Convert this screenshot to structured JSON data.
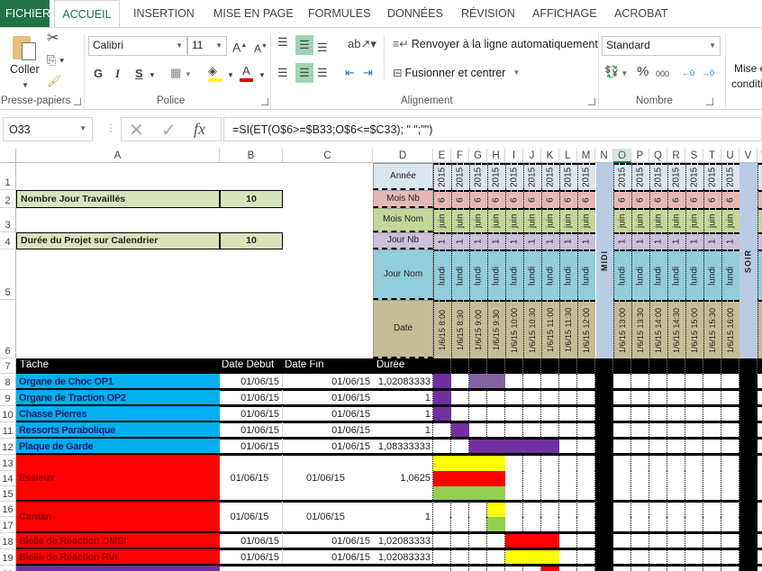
{
  "ribbon": {
    "tabs": [
      "FICHIER",
      "ACCUEIL",
      "INSERTION",
      "MISE EN PAGE",
      "FORMULES",
      "DONNÉES",
      "RÉVISION",
      "AFFICHAGE",
      "ACROBAT"
    ],
    "clipboard": {
      "paste": "Coller",
      "label": "Presse-papiers"
    },
    "font": {
      "name": "Calibri",
      "size": "11",
      "bold": "G",
      "italic": "I",
      "underline": "S",
      "label": "Police"
    },
    "alignment": {
      "wrap": "Renvoyer à la ligne automatiquement",
      "merge": "Fusionner et centrer",
      "label": "Alignement"
    },
    "number": {
      "format": "Standard",
      "percent": "%",
      "thousands": "000",
      "label": "Nombre"
    },
    "styles": {
      "conditional_line1": "Mise en",
      "conditional_line2": "conditionnelle"
    }
  },
  "formula_bar": {
    "name_box": "O33",
    "formula": "=SI(ET(O$6>=$B33;O$6<=$C33); \" \";\"\")",
    "fx": "fx"
  },
  "sheet": {
    "selected_column": "O",
    "summary": [
      {
        "row": 2,
        "label": "Nombre Jour Travaillés",
        "value": "10"
      },
      {
        "row": 4,
        "label": "Durée du Projet sur Calendrier",
        "value": "10"
      }
    ],
    "header_labels": [
      "Année",
      "Mois Nb",
      "Mois Nom",
      "Jour  Nb",
      "Jour Nom",
      "Date"
    ],
    "timeline": {
      "year": "2015",
      "month_nb": "6",
      "month_name": "juin",
      "day_nb": "1",
      "day_name": "lundi",
      "morning_times": [
        "1/6/15 8:00",
        "1/6/15 8:30",
        "1/6/15 9:00",
        "1/6/15 9:30",
        "1/6/15 10:00",
        "1/6/15 10:30",
        "1/6/15 11:00",
        "1/6/15 11:30",
        "1/6/15 12:00"
      ],
      "afternoon_times": [
        "1/6/15 13:00",
        "1/6/15 13:30",
        "1/6/15 14:00",
        "1/6/15 14:30",
        "1/6/15 15:00",
        "1/6/15 15:30",
        "1/6/15 16:00"
      ],
      "midi": "MIDI",
      "soir": "SOIR"
    },
    "table_headers": [
      "Tâche",
      "Date Début",
      "Date Fin",
      "Durée"
    ],
    "tasks": [
      {
        "name": "Organe de Choc OP1",
        "start": "01/06/15",
        "end": "01/06/15",
        "duration": "1,02083333",
        "color": "#00b0f0",
        "text_color": "#1f1f6b",
        "rows": [
          8
        ]
      },
      {
        "name": "Organe de Traction OP2",
        "start": "01/06/15",
        "end": "01/06/15",
        "duration": "1",
        "color": "#00b0f0",
        "text_color": "#1f1f6b",
        "rows": [
          9
        ]
      },
      {
        "name": "Chasse Pierres",
        "start": "01/06/15",
        "end": "01/06/15",
        "duration": "1",
        "color": "#00b0f0",
        "text_color": "#1f1f6b",
        "rows": [
          10
        ]
      },
      {
        "name": "Ressorts Parabolique",
        "start": "01/06/15",
        "end": "01/06/15",
        "duration": "1",
        "color": "#00b0f0",
        "text_color": "#1f1f6b",
        "rows": [
          11
        ]
      },
      {
        "name": "Plaque de Garde",
        "start": "01/06/15",
        "end": "01/06/15",
        "duration": "1,08333333",
        "color": "#00b0f0",
        "text_color": "#1f1f6b",
        "rows": [
          12
        ]
      },
      {
        "name": "Essieux",
        "start": "01/06/15",
        "end": "01/06/15",
        "duration": "1,0625",
        "color": "#ff0000",
        "text_color": "#8b0000",
        "rows": [
          13,
          14,
          15
        ]
      },
      {
        "name": "Cardan",
        "start": "01/06/15",
        "end": "01/06/15",
        "duration": "1",
        "color": "#ff0000",
        "text_color": "#8b0000",
        "rows": [
          16,
          17
        ]
      },
      {
        "name": "Bielle de Réaction OMSI",
        "start": "01/06/15",
        "end": "01/06/15",
        "duration": "1,02083333",
        "color": "#ff0000",
        "text_color": "#8b0000",
        "rows": [
          18
        ]
      },
      {
        "name": "Bielle de Réaction RVI",
        "start": "01/06/15",
        "end": "01/06/15",
        "duration": "1,02083333",
        "color": "#ff0000",
        "text_color": "#8b0000",
        "rows": [
          19
        ]
      }
    ],
    "partial_row_color": "#7030a0",
    "bars": [
      {
        "row": 8,
        "from": "E",
        "to": "E",
        "color": "#7030a0"
      },
      {
        "row": 8,
        "from": "G",
        "to": "H",
        "color": "#8064a2"
      },
      {
        "row": 9,
        "from": "E",
        "to": "E",
        "color": "#7030a0"
      },
      {
        "row": 10,
        "from": "E",
        "to": "E",
        "color": "#7030a0"
      },
      {
        "row": 11,
        "from": "F",
        "to": "F",
        "color": "#7030a0"
      },
      {
        "row": 12,
        "from": "G",
        "to": "K",
        "color": "#7030a0"
      },
      {
        "row": 13,
        "from": "E",
        "to": "H",
        "color": "#ffff00"
      },
      {
        "row": 14,
        "from": "E",
        "to": "H",
        "color": "#ff0000"
      },
      {
        "row": 15,
        "from": "E",
        "to": "H",
        "color": "#92d050"
      },
      {
        "row": 16,
        "from": "H",
        "to": "H",
        "color": "#ffff00"
      },
      {
        "row": 17,
        "from": "H",
        "to": "H",
        "color": "#92d050"
      },
      {
        "row": 18,
        "from": "I",
        "to": "K",
        "color": "#ff0000"
      },
      {
        "row": 19,
        "from": "I",
        "to": "K",
        "color": "#ffff00"
      },
      {
        "row": 20,
        "from": "K",
        "to": "K",
        "color": "#ff0000"
      }
    ],
    "colors": {
      "annee": "#dce6f1",
      "mois_nb": "#e6b8b7",
      "mois_nom": "#c4d79b",
      "jour_nb": "#ccc0da",
      "jour_nom": "#92cddc",
      "date": "#c4bd97",
      "break": "#b8cce4",
      "summary": "#d8e4bc",
      "accent": "#217346"
    }
  }
}
